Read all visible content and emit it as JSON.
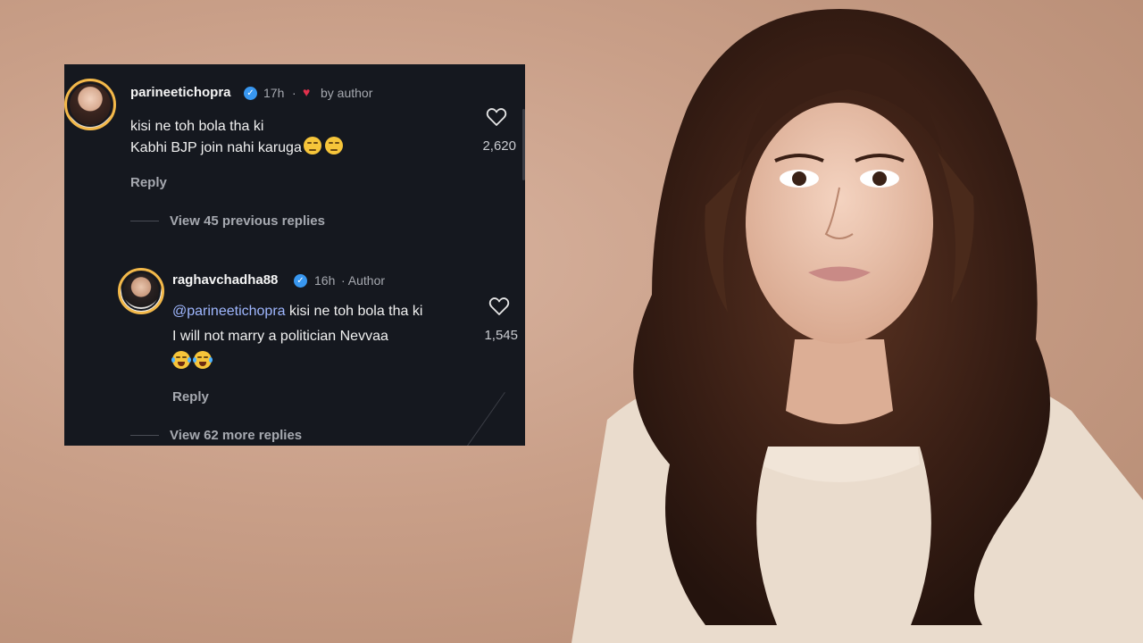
{
  "comment_thread": {
    "parent_comment": {
      "username": "parineetichopra",
      "time_ago": "17h",
      "separator": "·",
      "liked_by_author_label": "by author",
      "text_line_1": "kisi ne toh bola tha ki",
      "text_line_2": "Kabhi BJP join nahi karuga",
      "like_count": "2,620",
      "reply_label": "Reply"
    },
    "view_previous_replies": "View 45 previous replies",
    "reply_comment": {
      "username": "raghavchadha88",
      "time_ago": "16h",
      "author_label": "· Author",
      "mention": "@parineetichopra",
      "text_line_1": "kisi ne toh bola tha ki",
      "text_line_2": "I will not marry a politician Nevvaa",
      "like_count": "1,545",
      "reply_label": "Reply"
    },
    "view_more_replies": "View 62 more replies"
  },
  "colors": {
    "card_background": "#15181f",
    "verified_badge": "#3897f0",
    "author_heart": "#e1304c",
    "mention": "#9fb7ff",
    "page_background": "#c99f88"
  },
  "icons": {
    "verified": "verified-badge-icon",
    "author_heart": "heart-filled-icon",
    "like": "heart-outline-icon",
    "emoji_parent": "unamused-face-icon",
    "emoji_reply": "tears-of-joy-icon"
  }
}
